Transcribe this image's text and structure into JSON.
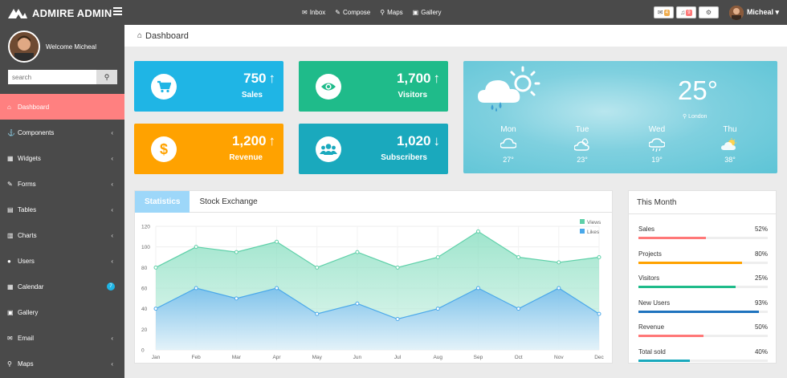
{
  "brand": {
    "name": "ADMIRE ADMIN"
  },
  "topnav": [
    {
      "label": "Inbox",
      "icon": "inbox-icon",
      "glyph": "✉"
    },
    {
      "label": "Compose",
      "icon": "compose-icon",
      "glyph": "✎"
    },
    {
      "label": "Maps",
      "icon": "map-marker-icon",
      "glyph": "⚲"
    },
    {
      "label": "Gallery",
      "icon": "picture-icon",
      "glyph": "▣"
    }
  ],
  "notifications": {
    "mail_count": "4",
    "bell_count": "9",
    "mail_color": "#f0ad4e",
    "bell_color": "#ff7878"
  },
  "user": {
    "name": "Micheal",
    "welcome": "Welcome Micheal"
  },
  "search": {
    "placeholder": "search"
  },
  "sidebar": {
    "items": [
      {
        "label": "Dashboard",
        "icon": "home-icon",
        "glyph": "⌂",
        "active": true
      },
      {
        "label": "Components",
        "icon": "anchor-icon",
        "glyph": "⚓",
        "chevron": true
      },
      {
        "label": "Widgets",
        "icon": "grid-icon",
        "glyph": "▦",
        "chevron": true
      },
      {
        "label": "Forms",
        "icon": "pencil-icon",
        "glyph": "✎",
        "chevron": true
      },
      {
        "label": "Tables",
        "icon": "table-icon",
        "glyph": "▤",
        "chevron": true
      },
      {
        "label": "Charts",
        "icon": "bar-chart-icon",
        "glyph": "▥",
        "chevron": true
      },
      {
        "label": "Users",
        "icon": "user-icon",
        "glyph": "●",
        "chevron": true
      },
      {
        "label": "Calendar",
        "icon": "calendar-icon",
        "glyph": "▦",
        "badge": "7"
      },
      {
        "label": "Gallery",
        "icon": "picture-icon",
        "glyph": "▣"
      },
      {
        "label": "Email",
        "icon": "envelope-icon",
        "glyph": "✉",
        "chevron": true
      },
      {
        "label": "Maps",
        "icon": "map-marker-icon",
        "glyph": "⚲",
        "chevron": true
      }
    ]
  },
  "page": {
    "title": "Dashboard"
  },
  "stats": [
    {
      "value": "750",
      "label": "Sales",
      "arrow": "↑",
      "color": "#1fb5e5",
      "icon": "cart-icon"
    },
    {
      "value": "1,700",
      "label": "Visitors",
      "arrow": "↑",
      "color": "#1fbb8a",
      "icon": "eye-icon"
    },
    {
      "value": "1,200",
      "label": "Revenue",
      "arrow": "↑",
      "color": "#ffa200",
      "icon": "dollar-icon"
    },
    {
      "value": "1,020",
      "label": "Subscribers",
      "arrow": "↓",
      "color": "#1aa9bd",
      "icon": "users-icon"
    }
  ],
  "weather": {
    "temperature": "25°",
    "location": "London",
    "days": [
      {
        "day": "Mon",
        "temp": "27°",
        "icon": "cloud-icon"
      },
      {
        "day": "Tue",
        "temp": "23°",
        "icon": "cloud-moon-icon"
      },
      {
        "day": "Wed",
        "temp": "19°",
        "icon": "cloud-rain-icon"
      },
      {
        "day": "Thu",
        "temp": "38°",
        "icon": "sun-cloud-icon"
      }
    ]
  },
  "chart_tabs": [
    {
      "label": "Statistics",
      "active": true
    },
    {
      "label": "Stock Exchange",
      "active": false
    }
  ],
  "chart_data": {
    "type": "area",
    "x": [
      "Jan",
      "Feb",
      "Mar",
      "Apr",
      "May",
      "Jun",
      "Jul",
      "Aug",
      "Sep",
      "Oct",
      "Nov",
      "Dec"
    ],
    "series": [
      {
        "name": "Views",
        "values": [
          80,
          100,
          95,
          105,
          80,
          95,
          80,
          90,
          115,
          90,
          85,
          90
        ],
        "color": "#5ed0a8"
      },
      {
        "name": "Likes",
        "values": [
          40,
          60,
          50,
          60,
          35,
          45,
          30,
          40,
          60,
          40,
          60,
          35
        ],
        "color": "#4aa8ea"
      }
    ],
    "ylim": [
      0,
      120
    ],
    "yticks": [
      0,
      20,
      40,
      60,
      80,
      100,
      120
    ],
    "grid": true,
    "legend": "top-right"
  },
  "this_month": {
    "title": "This Month",
    "items": [
      {
        "label": "Sales",
        "percent": 52,
        "text": "52%",
        "color": "#ff7878"
      },
      {
        "label": "Projects",
        "percent": 80,
        "text": "80%",
        "color": "#ffa200"
      },
      {
        "label": "Visitors",
        "percent": 75,
        "text": "25%",
        "color": "#1fbb8a"
      },
      {
        "label": "New Users",
        "percent": 93,
        "text": "93%",
        "color": "#1e73be"
      },
      {
        "label": "Revenue",
        "percent": 50,
        "text": "50%",
        "color": "#ff7878"
      },
      {
        "label": "Total sold",
        "percent": 40,
        "text": "40%",
        "color": "#1aa9bd"
      }
    ]
  }
}
